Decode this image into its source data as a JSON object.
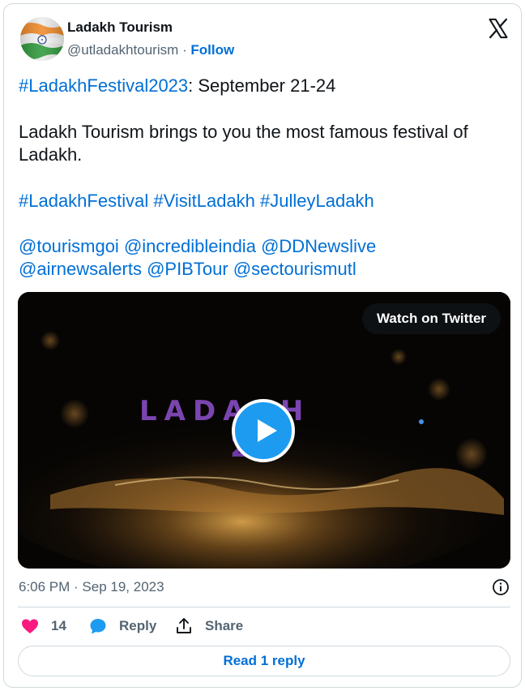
{
  "author": {
    "name": "Ladakh Tourism",
    "handle": "@utladakhtourism",
    "separator": "·",
    "follow_label": "Follow"
  },
  "tweet": {
    "line1_hashtag": "#LadakhFestival2023",
    "line1_rest": ": September 21-24",
    "body": "Ladakh Tourism brings to you the most famous festival of Ladakh.",
    "hashtags": [
      "#LadakhFestival",
      "#VisitLadakh",
      "#JulleyLadakh"
    ],
    "mentions_line1": [
      "@tourismgoi",
      "@incredibleindia",
      "@DDNewslive"
    ],
    "mentions_line2": [
      "@airnewsalerts",
      "@PIBTour",
      "@sectourismutl"
    ]
  },
  "media": {
    "watch_label": "Watch on Twitter",
    "overlay_title": "LADAKH",
    "overlay_sub": "2"
  },
  "footer": {
    "timestamp": "6:06 PM · Sep 19, 2023",
    "like_count": "14",
    "reply_label": "Reply",
    "share_label": "Share",
    "read_replies_label": "Read 1 reply"
  },
  "icons": {
    "x_logo": "x-logo-icon",
    "info": "info-icon",
    "like": "heart-icon",
    "reply": "speech-bubble-icon",
    "share": "upload-icon",
    "play": "play-icon"
  },
  "colors": {
    "link": "#006fd6",
    "like": "#f91880",
    "reply": "#1d9bf0",
    "muted": "#536471",
    "border": "#cfd9de"
  }
}
